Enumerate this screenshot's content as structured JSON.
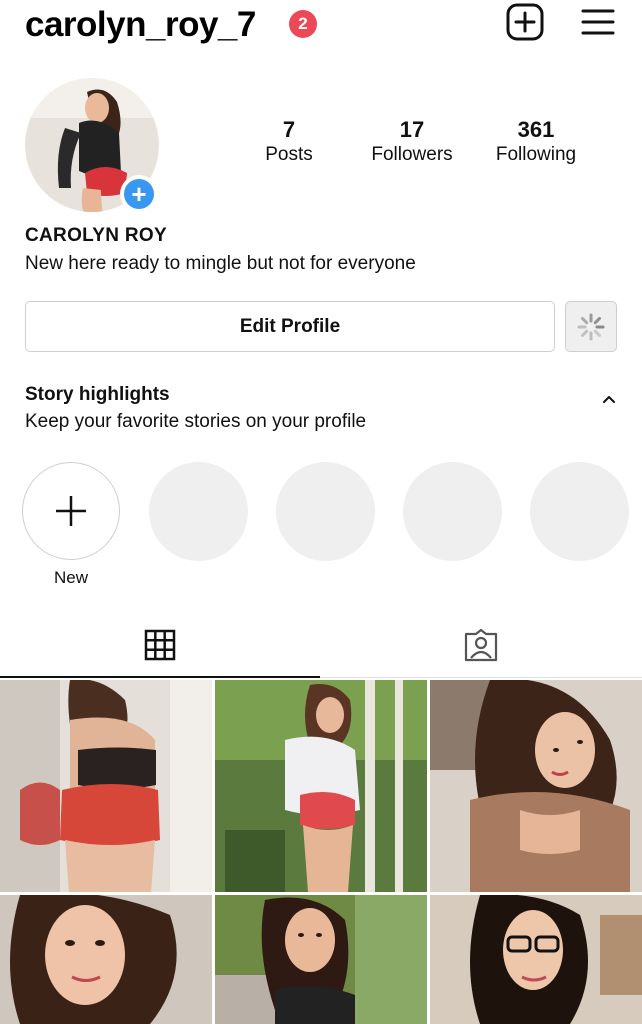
{
  "header": {
    "username": "carolyn_roy_7",
    "notification_count": "2",
    "new_post_icon": "plus-square-icon",
    "menu_icon": "hamburger-menu-icon"
  },
  "profile": {
    "stats": [
      {
        "value": "7",
        "label": "Posts"
      },
      {
        "value": "17",
        "label": "Followers"
      },
      {
        "value": "361",
        "label": "Following"
      }
    ],
    "full_name": "CAROLYN ROY",
    "bio": "New here ready to mingle but not for everyone"
  },
  "actions": {
    "edit_profile_label": "Edit Profile",
    "discover_icon": "loading-spinner-icon"
  },
  "highlights": {
    "title": "Story highlights",
    "subtitle": "Keep your favorite stories on your profile",
    "new_label": "New"
  },
  "tabs": {
    "grid_icon": "grid-icon",
    "tagged_icon": "tagged-person-icon"
  },
  "colors": {
    "notification_badge": "#ec4956",
    "add_story_blue": "#3897f0",
    "placeholder_gray": "#efefef"
  }
}
